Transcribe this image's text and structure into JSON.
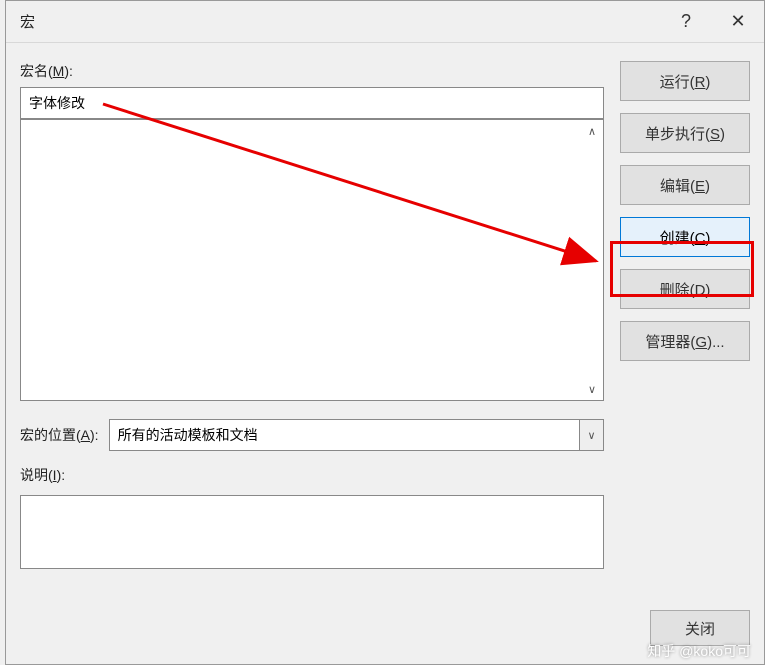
{
  "titlebar": {
    "title": "宏",
    "help": "?",
    "close": "✕"
  },
  "labels": {
    "macro_name": "宏名(M):",
    "macro_location": "宏的位置(A):",
    "description": "说明(I):"
  },
  "fields": {
    "macro_name_value": "字体修改",
    "location_selected": "所有的活动模板和文档",
    "description_value": ""
  },
  "buttons": {
    "run": "运行(R)",
    "step": "单步执行(S)",
    "edit": "编辑(E)",
    "create": "创建(C)",
    "delete": "删除(D)",
    "organizer": "管理器(G)...",
    "close": "关闭"
  },
  "watermark": "知乎 @koko可可"
}
